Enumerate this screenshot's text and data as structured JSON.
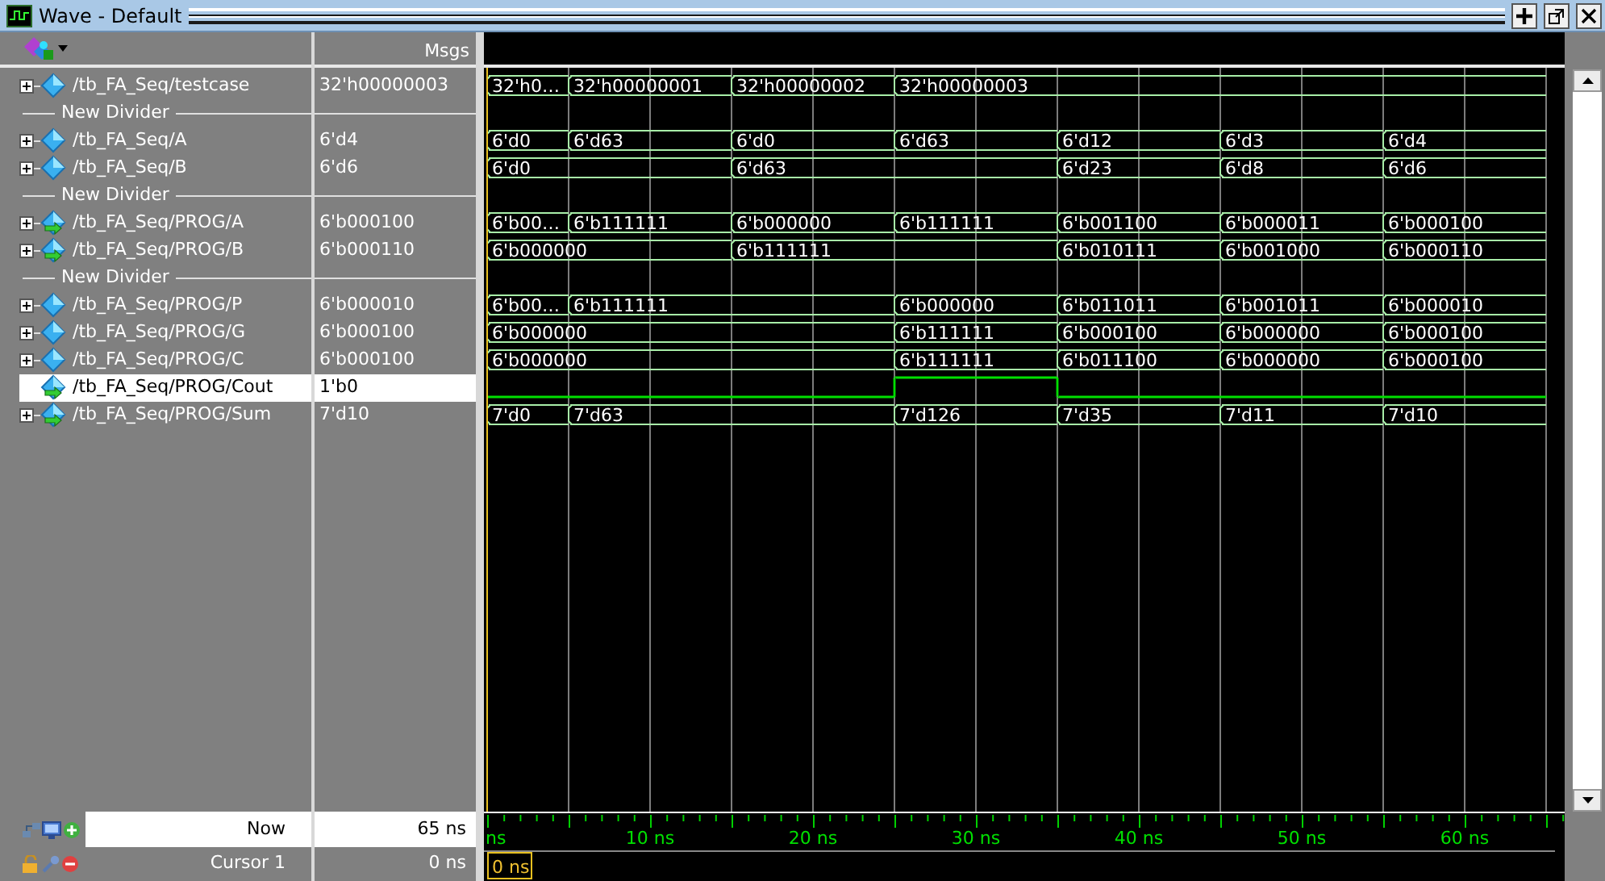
{
  "window": {
    "title": "Wave - Default"
  },
  "header": {
    "values_column": "Msgs"
  },
  "signals": [
    {
      "kind": "bus",
      "name": "/tb_FA_Seq/testcase",
      "value": "32'h00000003",
      "expandable": true,
      "port": false,
      "selected": false,
      "changes": [
        true,
        true,
        true,
        true,
        false,
        false,
        false
      ],
      "values": [
        "32'h0…",
        "32'h00000001",
        "32'h00000002",
        "32'h00000003"
      ]
    },
    {
      "kind": "divider",
      "label": "New Divider"
    },
    {
      "kind": "bus",
      "name": "/tb_FA_Seq/A",
      "value": "6'd4",
      "expandable": true,
      "port": false,
      "selected": false,
      "changes": [
        true,
        true,
        true,
        true,
        true,
        true,
        true
      ],
      "values": [
        "6'd0",
        "6'd63",
        "6'd0",
        "6'd63",
        "6'd12",
        "6'd3",
        "6'd4"
      ]
    },
    {
      "kind": "bus",
      "name": "/tb_FA_Seq/B",
      "value": "6'd6",
      "expandable": true,
      "port": false,
      "selected": false,
      "changes": [
        true,
        false,
        true,
        false,
        true,
        true,
        true
      ],
      "values": [
        "6'd0",
        "6'd63",
        "6'd23",
        "6'd8",
        "6'd6"
      ]
    },
    {
      "kind": "divider",
      "label": "New Divider"
    },
    {
      "kind": "bus",
      "name": "/tb_FA_Seq/PROG/A",
      "value": "6'b000100",
      "expandable": true,
      "port": true,
      "selected": false,
      "changes": [
        true,
        true,
        true,
        true,
        true,
        true,
        true
      ],
      "values": [
        "6'b00…",
        "6'b111111",
        "6'b000000",
        "6'b111111",
        "6'b001100",
        "6'b000011",
        "6'b000100"
      ]
    },
    {
      "kind": "bus",
      "name": "/tb_FA_Seq/PROG/B",
      "value": "6'b000110",
      "expandable": true,
      "port": true,
      "selected": false,
      "changes": [
        true,
        false,
        true,
        false,
        true,
        true,
        true
      ],
      "values": [
        "6'b000000",
        "6'b111111",
        "6'b010111",
        "6'b001000",
        "6'b000110"
      ]
    },
    {
      "kind": "divider",
      "label": "New Divider"
    },
    {
      "kind": "bus",
      "name": "/tb_FA_Seq/PROG/P",
      "value": "6'b000010",
      "expandable": true,
      "port": false,
      "selected": false,
      "changes": [
        true,
        true,
        false,
        true,
        true,
        true,
        true
      ],
      "values": [
        "6'b00…",
        "6'b111111",
        "6'b000000",
        "6'b011011",
        "6'b001011",
        "6'b000010"
      ]
    },
    {
      "kind": "bus",
      "name": "/tb_FA_Seq/PROG/G",
      "value": "6'b000100",
      "expandable": true,
      "port": false,
      "selected": false,
      "changes": [
        true,
        false,
        false,
        true,
        true,
        true,
        true
      ],
      "values": [
        "6'b000000",
        "6'b111111",
        "6'b000100",
        "6'b000000",
        "6'b000100"
      ]
    },
    {
      "kind": "bus",
      "name": "/tb_FA_Seq/PROG/C",
      "value": "6'b000100",
      "expandable": true,
      "port": false,
      "selected": false,
      "changes": [
        true,
        false,
        false,
        true,
        true,
        true,
        true
      ],
      "values": [
        "6'b000000",
        "6'b111111",
        "6'b011100",
        "6'b000000",
        "6'b000100"
      ]
    },
    {
      "kind": "bit",
      "name": "/tb_FA_Seq/PROG/Cout",
      "value": "1'b0",
      "expandable": false,
      "port": true,
      "selected": true,
      "high": [
        false,
        false,
        false,
        true,
        false,
        false,
        false
      ]
    },
    {
      "kind": "bus",
      "name": "/tb_FA_Seq/PROG/Sum",
      "value": "7'd10",
      "expandable": true,
      "port": true,
      "selected": false,
      "changes": [
        true,
        true,
        false,
        true,
        true,
        true,
        true
      ],
      "values": [
        "7'd0",
        "7'd63",
        "7'd126",
        "7'd35",
        "7'd11",
        "7'd10"
      ]
    }
  ],
  "now": {
    "label": "Now",
    "value": "65 ns"
  },
  "cursor": {
    "label": "Cursor 1",
    "value": "0 ns",
    "marker": "0 ns"
  },
  "timeline": {
    "labels": [
      "ns",
      "10 ns",
      "20 ns",
      "30 ns",
      "40 ns",
      "50 ns",
      "60 ns"
    ]
  }
}
